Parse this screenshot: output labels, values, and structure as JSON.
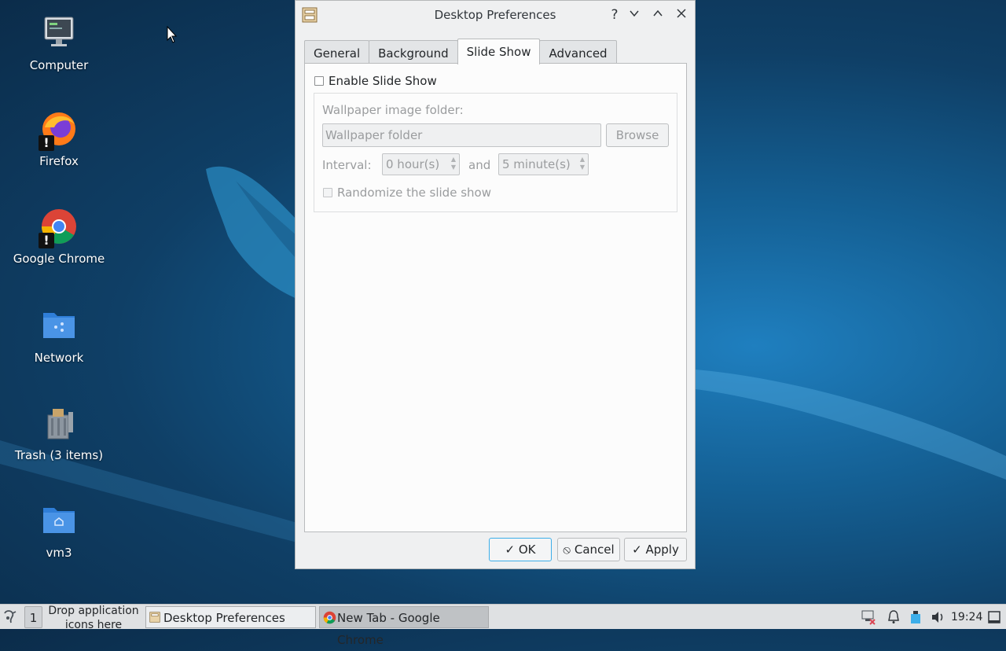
{
  "desktop": {
    "icons": [
      {
        "label": "Computer",
        "icon": "computer-icon"
      },
      {
        "label": "Firefox",
        "icon": "firefox-icon"
      },
      {
        "label": "Google Chrome",
        "icon": "chrome-icon"
      },
      {
        "label": "Network",
        "icon": "network-folder-icon"
      },
      {
        "label": "Trash (3 items)",
        "icon": "trash-icon"
      },
      {
        "label": "vm3",
        "icon": "home-folder-icon"
      }
    ]
  },
  "dialog": {
    "title": "Desktop Preferences",
    "titlebar_buttons": {
      "help": "?",
      "minimize": "⌄",
      "maximize": "⌃",
      "close": "✕"
    },
    "tabs": [
      {
        "label": "General",
        "active": false
      },
      {
        "label": "Background",
        "active": false
      },
      {
        "label": "Slide Show",
        "active": true
      },
      {
        "label": "Advanced",
        "active": false
      }
    ],
    "slideshow": {
      "enable_label": "Enable Slide Show",
      "enabled": false,
      "folder_label": "Wallpaper image folder:",
      "folder_placeholder": "Wallpaper folder",
      "browse_label": "Browse",
      "interval_label": "Interval:",
      "hours_value": "0 hour(s)",
      "and_label": "and",
      "minutes_value": "5 minute(s)",
      "randomize_label": "Randomize the slide show"
    },
    "buttons": {
      "ok": "OK",
      "cancel": "Cancel",
      "apply": "Apply"
    }
  },
  "taskbar": {
    "workspace": "1",
    "quicklaunch_hint": "Drop application icons here",
    "tasks": [
      {
        "label": "Desktop Preferences",
        "active": false
      },
      {
        "label": "New Tab - Google Chrome",
        "active": true
      }
    ],
    "clock": "19:24"
  },
  "colors": {
    "accent": "#3daee9",
    "dialog_bg": "#eff0f1",
    "panel_bg": "#fcfcfc"
  }
}
